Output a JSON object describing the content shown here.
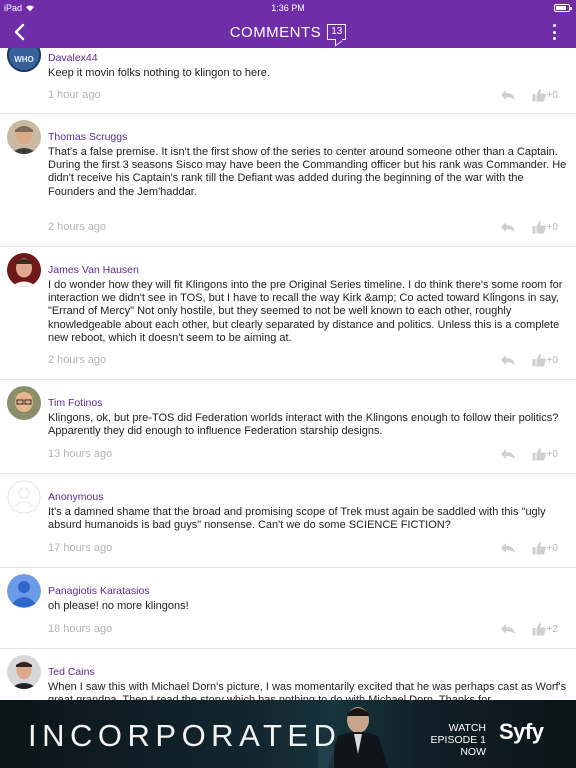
{
  "status_bar": {
    "carrier": "iPad",
    "time": "1:36 PM"
  },
  "header": {
    "title": "COMMENTS",
    "comment_count": "13"
  },
  "comments": [
    {
      "author": "Davalex44",
      "text": "Keep it movin folks nothing to klingon to here.",
      "time": "1 hour ago",
      "likes": "+0",
      "avatar": "who-logo"
    },
    {
      "author": "Thomas Scruggs",
      "text": "That's a false premise. It isn't the first show of the series to center around someone other than a Captain. During the first 3 seasons Sisco may have been the Commanding officer but his rank was Commander. He didn't receive his Captain's rank till the Defiant was added during the beginning of the war with the Founders and the Jem'haddar.",
      "time": "2 hours ago",
      "likes": "+0",
      "avatar": "photo"
    },
    {
      "author": "James Van Hausen",
      "text": "I do wonder how they will fit Klingons into the pre Original Series timeline. I do think there's some room for interaction we didn't see in TOS, but I have to recall the way Kirk &amp; Co acted toward Klingons in say, \"Errand of Mercy\" Not only hostile, but they seemed to not be well known to each other, roughly knowledgeable about each other, but clearly separated by distance and politics. Unless this is a complete new reboot, which it doesn't seem to be aiming at.",
      "time": "2 hours ago",
      "likes": "+0",
      "avatar": "photo"
    },
    {
      "author": "Tim Fotinos",
      "text": "Klingons, ok, but pre-TOS did Federation worlds interact with the Klingons enough to follow their politics? Apparently they did enough to influence Federation starship designs.",
      "time": "13 hours ago",
      "likes": "+0",
      "avatar": "photo"
    },
    {
      "author": "Anonymous",
      "text": "It's a damned shame that the broad and promising scope of Trek must again be saddled with this \"ugly absurd humanoids is bad guys\" nonsense. Can't we do some SCIENCE FICTION?",
      "time": "17 hours ago",
      "likes": "+0",
      "avatar": "anonymous"
    },
    {
      "author": "Panagiotis Karatasios",
      "text": "oh please! no more klingons!",
      "time": "18 hours ago",
      "likes": "+2",
      "avatar": "default-person"
    },
    {
      "author": "Ted Cains",
      "text": "When I saw this with Michael Dorn's picture, I was momentarily excited that he was perhaps cast as Worf's great grandpa. Then I read the story which has nothing to do with Michael Dorn. Thanks for",
      "time": "",
      "likes": "",
      "avatar": "photo"
    }
  ],
  "ad": {
    "brand": "INCORPORATED",
    "cta_line1": "WATCH",
    "cta_line2": "EPISODE 1 NOW",
    "network": "Syfy"
  },
  "colors": {
    "header_bg": "#6f2da8",
    "author_name": "#5b2a8f",
    "timestamp": "#b5b5b5"
  }
}
